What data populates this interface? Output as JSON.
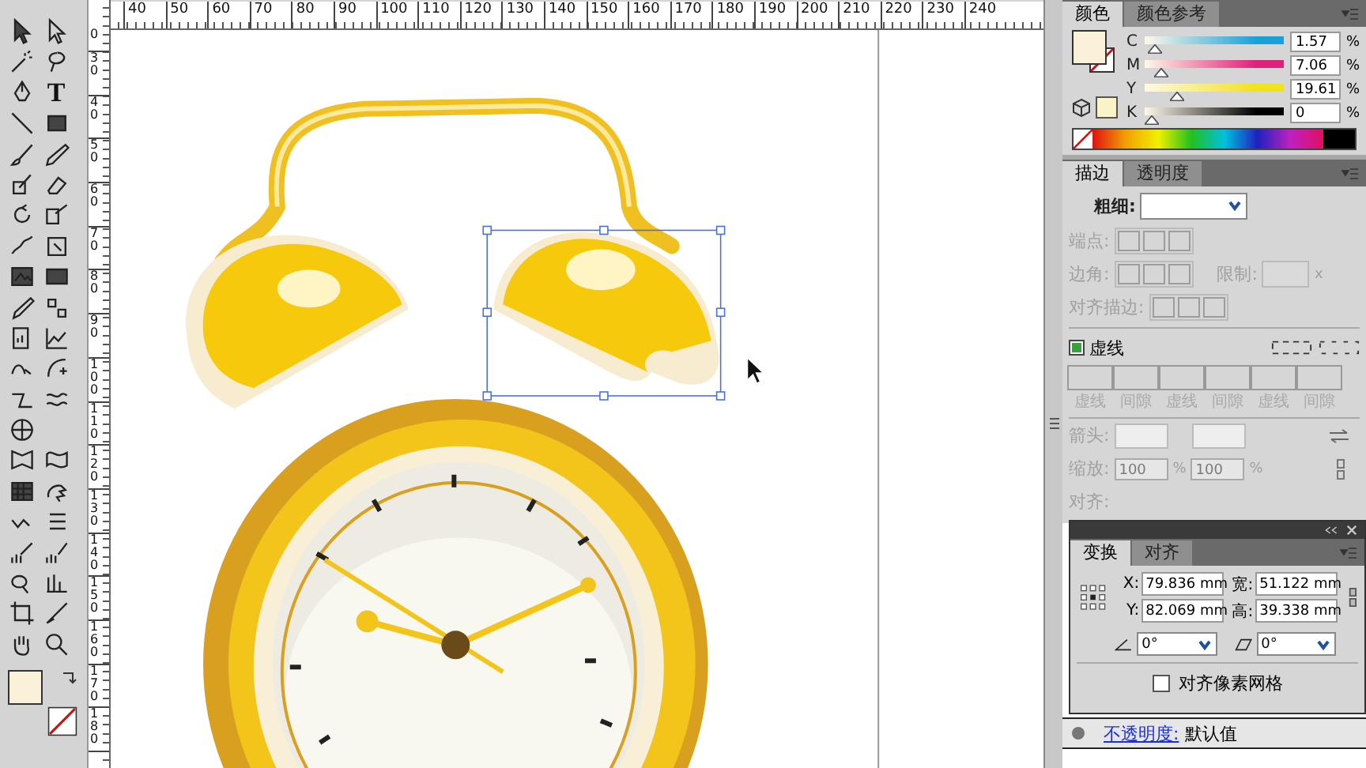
{
  "toolbar": {
    "type_tool": "T"
  },
  "rulers": {
    "horizontal": [
      "40",
      "50",
      "60",
      "70",
      "80",
      "90",
      "100",
      "110",
      "120",
      "130",
      "140",
      "150",
      "160",
      "170",
      "180",
      "190",
      "200",
      "210",
      "220",
      "230",
      "240"
    ],
    "vertical": [
      "0",
      "30",
      "40",
      "50",
      "60",
      "70",
      "80",
      "90",
      "100",
      "110",
      "120",
      "130",
      "140",
      "150",
      "160",
      "170",
      "180"
    ]
  },
  "color_panel": {
    "tabs": [
      {
        "label": "颜色",
        "selected": true
      },
      {
        "label": "颜色参考",
        "selected": false
      }
    ],
    "channels": [
      {
        "name": "C",
        "level": 0.0157,
        "value": "1.57",
        "unit": "%",
        "color": "#1aa0d8"
      },
      {
        "name": "M",
        "level": 0.0706,
        "value": "7.06",
        "unit": "%",
        "color": "#e0207a"
      },
      {
        "name": "Y",
        "level": 0.1961,
        "value": "19.61",
        "unit": "%",
        "color": "#f2e21a"
      },
      {
        "name": "K",
        "level": 0,
        "value": "0",
        "unit": "%",
        "color": "#000000"
      }
    ]
  },
  "stroke_panel": {
    "tabs": [
      {
        "label": "描边",
        "selected": true
      },
      {
        "label": "透明度",
        "selected": false
      }
    ],
    "weight_label": "粗细:",
    "options_disabled": true,
    "cap_label": "端点:",
    "corner_label": "边角:",
    "limit_label": "限制:",
    "limit_unit": "x",
    "align_label": "对齐描边:",
    "dashed": {
      "label": "虚线",
      "checked": true
    },
    "dash_fields": [
      {
        "label": "虚线"
      },
      {
        "label": "间隙"
      },
      {
        "label": "虚线"
      },
      {
        "label": "间隙"
      },
      {
        "label": "虚线"
      },
      {
        "label": "间隙"
      }
    ],
    "arrow_label": "箭头:",
    "scale_label": "缩放:",
    "scale_values": [
      {
        "value": "100",
        "unit": "%"
      },
      {
        "value": "100",
        "unit": "%"
      }
    ],
    "arrange_label": "对齐:"
  },
  "transform_panel": {
    "tabs": [
      {
        "label": "变换",
        "selected": true
      },
      {
        "label": "对齐",
        "selected": false
      }
    ],
    "fields": [
      {
        "label": "X:",
        "value": "79.836 mm"
      },
      {
        "label": "宽:",
        "value": "51.122 mm"
      },
      {
        "label": "Y:",
        "value": "82.069 mm"
      },
      {
        "label": "高:",
        "value": "39.338 mm"
      }
    ],
    "angle": "0°",
    "shear": "0°",
    "snap": {
      "label": "对齐像素网格",
      "checked": false
    }
  },
  "appearance": {
    "link": "不透明度:",
    "value": "默认值"
  }
}
